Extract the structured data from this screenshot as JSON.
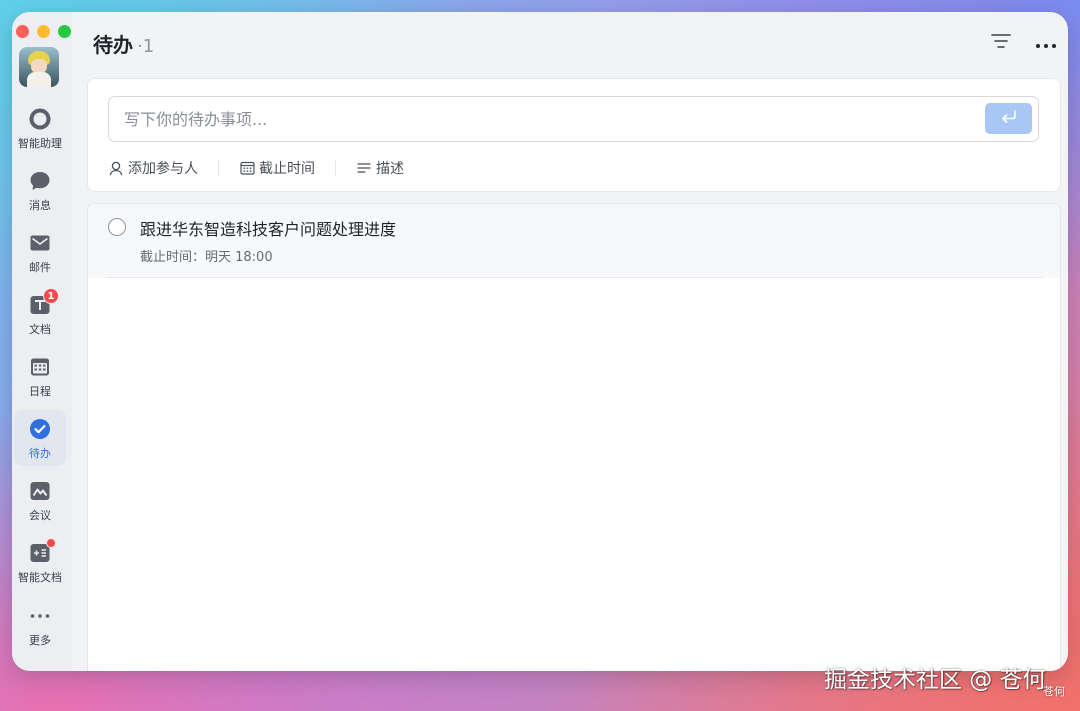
{
  "window": {
    "traffic_colors": [
      "#fe5f57",
      "#febc2e",
      "#28c840"
    ]
  },
  "sidebar": {
    "avatar_icon": "user-avatar",
    "items": [
      {
        "label": "智能助理",
        "icon": "assistant-ring-icon"
      },
      {
        "label": "消息",
        "icon": "chat-bubble-icon"
      },
      {
        "label": "邮件",
        "icon": "mail-icon"
      },
      {
        "label": "文档",
        "icon": "doc-icon",
        "badge": "1"
      },
      {
        "label": "日程",
        "icon": "calendar-icon"
      },
      {
        "label": "待办",
        "icon": "check-circle-icon",
        "active": true
      },
      {
        "label": "会议",
        "icon": "meeting-icon"
      },
      {
        "label": "智能文档",
        "icon": "smart-doc-icon",
        "dot": true
      },
      {
        "label": "更多",
        "icon": "more-dots-icon"
      }
    ]
  },
  "header": {
    "title": "待办",
    "count": "·1",
    "filter_icon": "filter-lines-icon",
    "more_icon": "more-horizontal-icon"
  },
  "composer": {
    "placeholder": "写下你的待办事项...",
    "submit_icon": "enter-arrow-icon",
    "options": [
      {
        "label": "添加参与人",
        "icon": "person-icon"
      },
      {
        "label": "截止时间",
        "icon": "calendar-grid-icon"
      },
      {
        "label": "描述",
        "icon": "description-lines-icon"
      }
    ]
  },
  "todos": [
    {
      "title": "跟进华东智造科技客户问题处理进度",
      "due": "截止时间：明天 18:00"
    }
  ],
  "watermark": {
    "text": "掘金技术社区 @ 苍何",
    "small": "苍何"
  },
  "colors": {
    "accent": "#2f6fdf",
    "submit_disabled": "#a9c7f5",
    "badge": "#f5484c"
  }
}
